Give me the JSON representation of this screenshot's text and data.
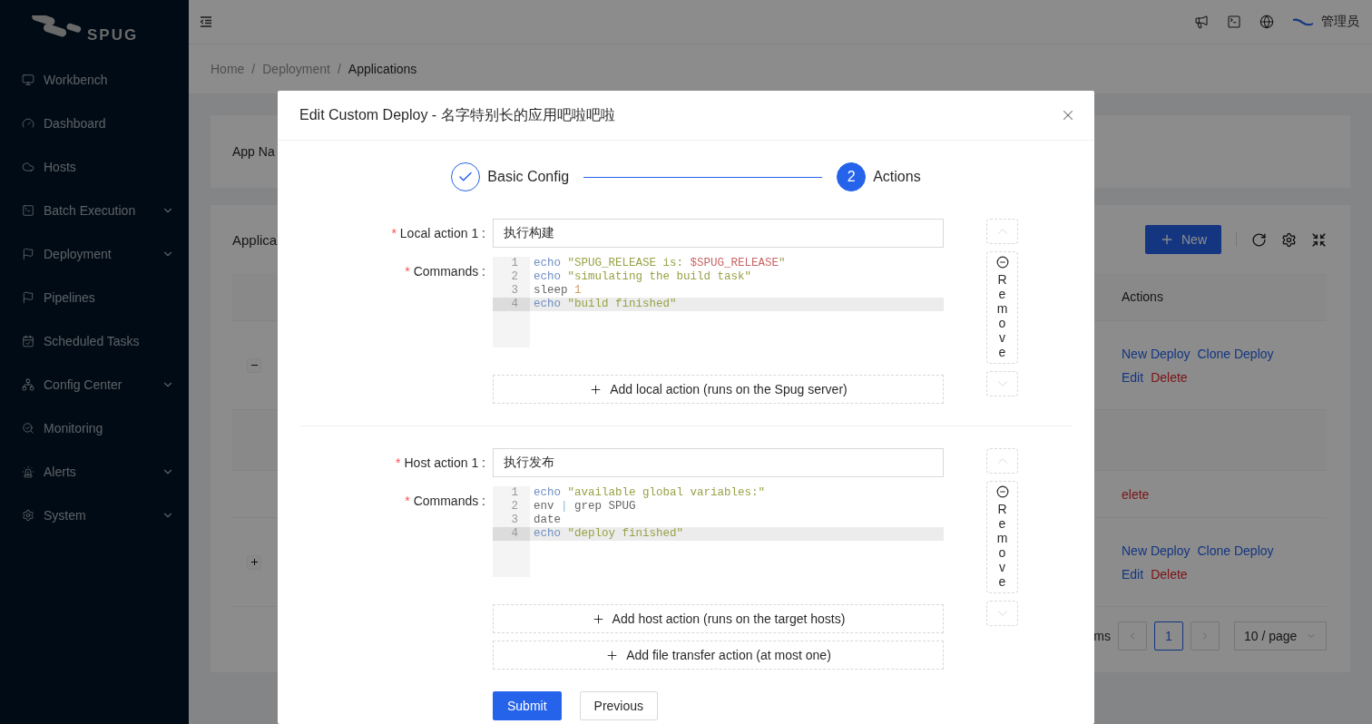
{
  "sidebar": {
    "logo_text": "SPUG",
    "items": [
      {
        "label": "Workbench",
        "expandable": false
      },
      {
        "label": "Dashboard",
        "expandable": false
      },
      {
        "label": "Hosts",
        "expandable": false
      },
      {
        "label": "Batch Execution",
        "expandable": true
      },
      {
        "label": "Deployment",
        "expandable": true
      },
      {
        "label": "Pipelines",
        "expandable": false
      },
      {
        "label": "Scheduled Tasks",
        "expandable": false
      },
      {
        "label": "Config Center",
        "expandable": true
      },
      {
        "label": "Monitoring",
        "expandable": false
      },
      {
        "label": "Alerts",
        "expandable": true
      },
      {
        "label": "System",
        "expandable": true
      }
    ]
  },
  "header": {
    "user": "管理员"
  },
  "breadcrumb": [
    {
      "label": "Home",
      "current": false
    },
    {
      "label": "Deployment",
      "current": false
    },
    {
      "label": "Applications",
      "current": true
    }
  ],
  "breadcrumb_separator": "/",
  "filter_card": {
    "label": "App Na"
  },
  "table_card": {
    "title": "Applica",
    "new_button": "New",
    "columns": [
      "Actions"
    ],
    "rows": [
      {
        "kind": "app",
        "expanded": true,
        "actions": [
          [
            {
              "label": "New Deploy",
              "kind": "link"
            },
            {
              "label": "Clone Deploy",
              "kind": "link"
            }
          ],
          [
            {
              "label": "Edit",
              "kind": "link"
            },
            {
              "label": "Delete",
              "kind": "danger"
            }
          ]
        ]
      },
      {
        "kind": "subheader"
      },
      {
        "kind": "sub",
        "actions": [
          [
            {
              "label": "elete",
              "kind": "danger"
            }
          ]
        ]
      },
      {
        "kind": "app",
        "expanded": false,
        "actions": [
          [
            {
              "label": "New Deploy",
              "kind": "link"
            },
            {
              "label": "Clone Deploy",
              "kind": "link"
            }
          ],
          [
            {
              "label": "Edit",
              "kind": "link"
            },
            {
              "label": "Delete",
              "kind": "danger"
            }
          ]
        ]
      }
    ],
    "pagination": {
      "total_text": "ms",
      "pages": [
        {
          "label": "1",
          "selected": true
        }
      ],
      "page_size": "10 / page"
    }
  },
  "modal": {
    "title": "Edit Custom Deploy - 名字特别长的应用吧啦吧啦",
    "steps": [
      {
        "label": "Basic Config",
        "completed": true
      },
      {
        "label": "Actions",
        "number": "2",
        "completed": false
      }
    ],
    "sections": [
      {
        "action": {
          "label": "Local action 1 :",
          "required_mark": "*",
          "value": "执行构建",
          "commands_label": "Commands :",
          "commands_required_mark": "*",
          "remove_label": "Remove",
          "lines": [
            {
              "number": "1",
              "active": false,
              "tokens": [
                {
                  "kind": "keyword",
                  "text": "echo "
                },
                {
                  "kind": "string",
                  "text": "\"SPUG_RELEASE is: "
                },
                {
                  "kind": "variable",
                  "text": "$SPUG_RELEASE"
                },
                {
                  "kind": "string",
                  "text": "\""
                }
              ]
            },
            {
              "number": "2",
              "active": false,
              "tokens": [
                {
                  "kind": "keyword",
                  "text": "echo "
                },
                {
                  "kind": "string",
                  "text": "\"simulating the build task\""
                }
              ]
            },
            {
              "number": "3",
              "active": false,
              "tokens": [
                {
                  "kind": "plain",
                  "text": "sleep "
                },
                {
                  "kind": "number",
                  "text": "1"
                }
              ]
            },
            {
              "number": "4",
              "active": true,
              "tokens": [
                {
                  "kind": "keyword",
                  "text": "echo "
                },
                {
                  "kind": "string",
                  "text": "\"build finished\""
                }
              ]
            }
          ]
        },
        "add_buttons": [
          "Add local action (runs on the Spug server)"
        ]
      },
      {
        "action": {
          "label": "Host action 1 :",
          "required_mark": "*",
          "value": "执行发布",
          "commands_label": "Commands :",
          "commands_required_mark": "*",
          "remove_label": "Remove",
          "lines": [
            {
              "number": "1",
              "active": false,
              "tokens": [
                {
                  "kind": "keyword",
                  "text": "echo "
                },
                {
                  "kind": "string",
                  "text": "\"available global variables:\""
                }
              ]
            },
            {
              "number": "2",
              "active": false,
              "tokens": [
                {
                  "kind": "plain",
                  "text": "env "
                },
                {
                  "kind": "operator",
                  "text": "|"
                },
                {
                  "kind": "plain",
                  "text": " grep SPUG"
                }
              ]
            },
            {
              "number": "3",
              "active": false,
              "tokens": [
                {
                  "kind": "plain",
                  "text": "date"
                }
              ]
            },
            {
              "number": "4",
              "active": true,
              "tokens": [
                {
                  "kind": "keyword",
                  "text": "echo "
                },
                {
                  "kind": "string",
                  "text": "\"deploy finished\""
                }
              ]
            }
          ]
        },
        "add_buttons": [
          "Add host action (runs on the target hosts)",
          "Add file transfer action (at most one)"
        ]
      }
    ],
    "submit": "Submit",
    "previous": "Previous"
  }
}
